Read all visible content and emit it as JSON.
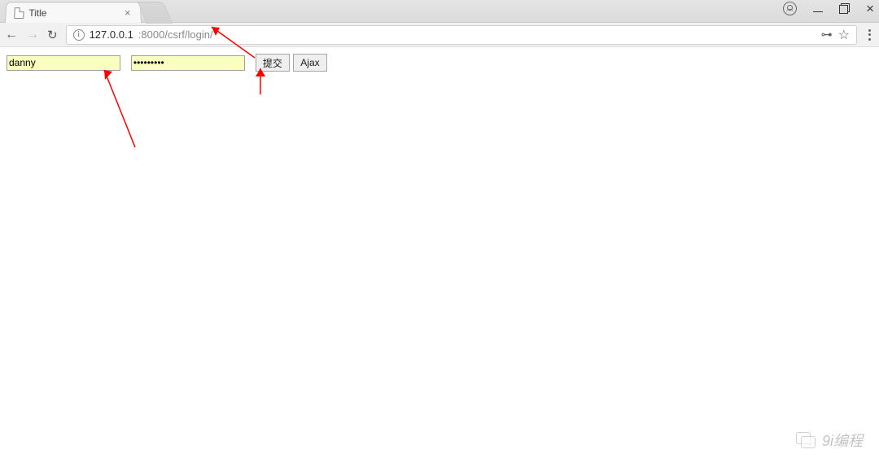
{
  "browser": {
    "tab": {
      "title": "Title",
      "favicon": "file"
    },
    "nav": {
      "back_enabled": true,
      "forward_enabled": false
    },
    "omnibox": {
      "scheme_icon": "info",
      "host": "127.0.0.1",
      "port_path": ":8000/csrf/login/",
      "saved_password_icon": "key",
      "star_icon": "star"
    },
    "window": {
      "user_icon": "account"
    }
  },
  "form": {
    "username": {
      "value": "danny"
    },
    "password": {
      "value": "•••••••••"
    },
    "submit_label": "提交",
    "ajax_label": "Ajax"
  },
  "annotations": {
    "arrow_color": "#ff0000"
  },
  "watermark": {
    "text": "9i编程"
  }
}
